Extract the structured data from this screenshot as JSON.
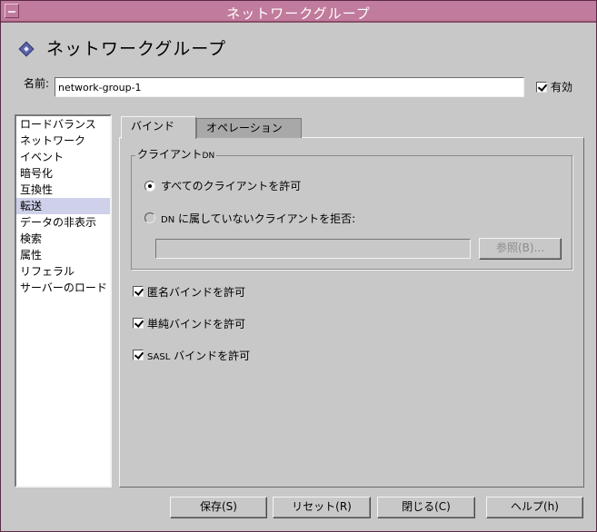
{
  "window": {
    "title": "ネットワークグループ"
  },
  "header": {
    "title": "ネットワークグループ",
    "icon": "diamond-icon"
  },
  "name_field": {
    "label": "名前:",
    "value": "network-group-1"
  },
  "enabled": {
    "label": "有効",
    "checked": true
  },
  "sidebar": {
    "items": [
      {
        "label": "ロードバランス",
        "selected": false
      },
      {
        "label": "ネットワーク",
        "selected": false
      },
      {
        "label": "イベント",
        "selected": false
      },
      {
        "label": "暗号化",
        "selected": false
      },
      {
        "label": "互換性",
        "selected": false
      },
      {
        "label": "転送",
        "selected": true
      },
      {
        "label": "データの非表示",
        "selected": false
      },
      {
        "label": "検索",
        "selected": false
      },
      {
        "label": "属性",
        "selected": false
      },
      {
        "label": "リフェラル",
        "selected": false
      },
      {
        "label": "サーバーのロード",
        "selected": false
      }
    ]
  },
  "tabs": [
    {
      "label": "バインド",
      "active": true
    },
    {
      "label": "オペレーション",
      "active": false
    }
  ],
  "client_dn": {
    "legend_main": "クライアント",
    "legend_small": "DN",
    "option_all": "すべてのクライアントを許可",
    "option_reject_prefix": "DN",
    "option_reject_suffix": "に属していないクライアントを拒否:",
    "selected": "all",
    "dn_value": "",
    "browse_label": "参照(B)..."
  },
  "bind_options": {
    "anonymous": {
      "label": "匿名バインドを許可",
      "checked": true
    },
    "simple": {
      "label": "単純バインドを許可",
      "checked": true
    },
    "sasl_prefix": "SASL",
    "sasl": {
      "label": "バインドを許可",
      "checked": true
    }
  },
  "footer": {
    "save": "保存(S)",
    "reset": "リセット(R)",
    "close": "閉じる(C)",
    "help": "ヘルプ(h)"
  },
  "colors": {
    "titlebar": "#c17b9c",
    "window_bg": "#c8c8c8",
    "selection": "#cfd0ea"
  }
}
